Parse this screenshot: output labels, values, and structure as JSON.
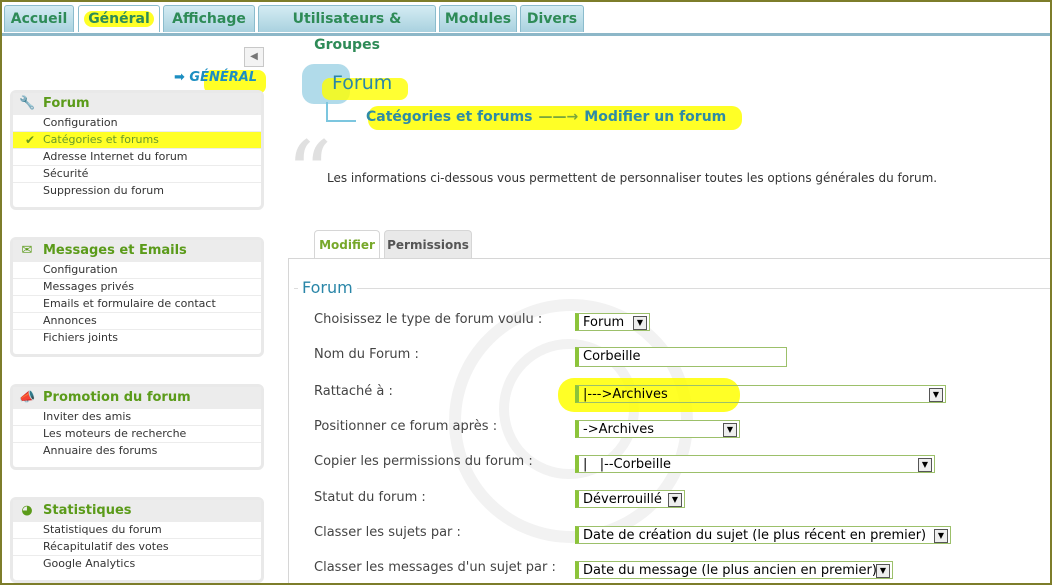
{
  "top_tabs": [
    {
      "label": "Accueil",
      "active": false
    },
    {
      "label": "Général",
      "active": true
    },
    {
      "label": "Affichage",
      "active": false
    },
    {
      "label": "Utilisateurs & Groupes",
      "active": false
    },
    {
      "label": "Modules",
      "active": false
    },
    {
      "label": "Divers",
      "active": false
    }
  ],
  "sidebar": {
    "section_link": "➡ GÉNÉRAL",
    "collapse_glyph": "◀",
    "boxes": [
      {
        "title": "Forum",
        "icon": "wrench-icon",
        "glyph": "🔧",
        "items": [
          "Configuration",
          "Catégories et forums",
          "Adresse Internet du forum",
          "Sécurité",
          "Suppression du forum"
        ],
        "current": 1
      },
      {
        "title": "Messages et Emails",
        "icon": "mail-icon",
        "glyph": "✉",
        "items": [
          "Configuration",
          "Messages privés",
          "Emails et formulaire de contact",
          "Annonces",
          "Fichiers joints"
        ],
        "current": -1
      },
      {
        "title": "Promotion du forum",
        "icon": "megaphone-icon",
        "glyph": "📣",
        "items": [
          "Inviter des amis",
          "Les moteurs de recherche",
          "Annuaire des forums"
        ],
        "current": -1
      },
      {
        "title": "Statistiques",
        "icon": "pie-chart-icon",
        "glyph": "◕",
        "items": [
          "Statistiques du forum",
          "Récapitulatif des votes",
          "Google Analytics"
        ],
        "current": -1
      }
    ]
  },
  "main": {
    "title": "Forum",
    "breadcrumb_1": "Catégories et forums",
    "breadcrumb_arrow": "——→",
    "breadcrumb_2": "Modifier un forum",
    "quote_glyph": "“",
    "intro": "Les informations ci-dessous vous permettent de personnaliser toutes les options générales du forum.",
    "subtabs": [
      "Modifier",
      "Permissions"
    ],
    "fieldset_title": "Forum",
    "fields": [
      {
        "label": "Choisissez le type de forum voulu :",
        "value": "Forum"
      },
      {
        "label": "Nom du Forum :",
        "value": "Corbeille"
      },
      {
        "label": "Rattaché à :",
        "value": "|--->Archives"
      },
      {
        "label": "Positionner ce forum après :",
        "value": "->Archives"
      },
      {
        "label": "Copier les permissions du forum :",
        "value": "|   |--Corbeille"
      },
      {
        "label": "Statut du forum :",
        "value": "Déverrouillé"
      },
      {
        "label": "Classer les sujets par :",
        "value": "Date de création du sujet (le plus récent en premier)"
      },
      {
        "label": "Classer les messages d'un sujet par :",
        "value": "Date du message (le plus ancien en premier)"
      }
    ],
    "dropdown_glyph": "▼"
  }
}
